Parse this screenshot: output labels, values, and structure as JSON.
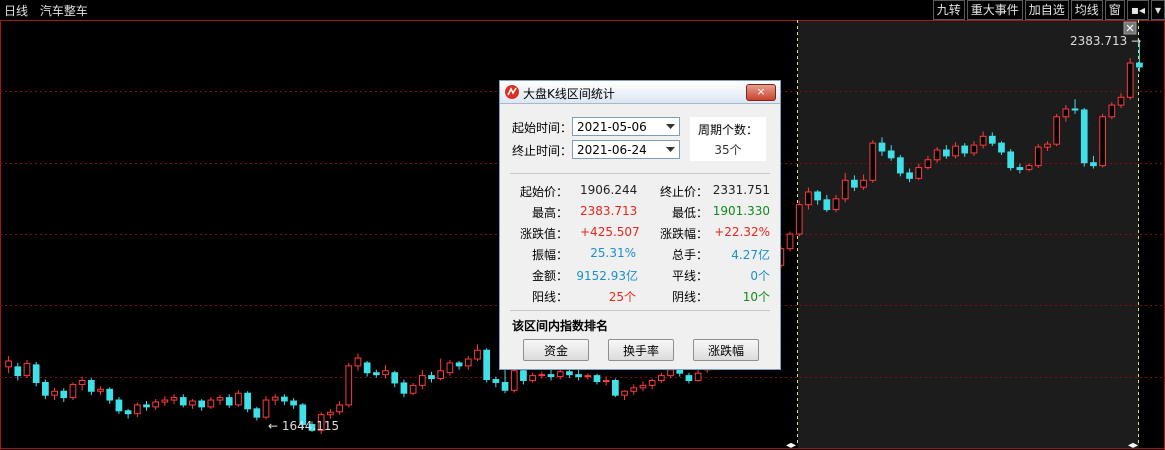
{
  "header": {
    "period": "日线",
    "sector": "汽车整车"
  },
  "toolbar": [
    "九转",
    "重大事件",
    "加自选",
    "均线",
    "窗",
    "▪◂",
    "▾"
  ],
  "chart_data": {
    "type": "candlestick",
    "max_label": "2383.713",
    "min_label": "1644.115",
    "candles": [
      [
        1718,
        1730,
        1705,
        1740
      ],
      [
        1718,
        1700,
        1690,
        1726
      ],
      [
        1700,
        1725,
        1695,
        1732
      ],
      [
        1722,
        1686,
        1678,
        1728
      ],
      [
        1686,
        1660,
        1652,
        1692
      ],
      [
        1660,
        1668,
        1650,
        1675
      ],
      [
        1668,
        1655,
        1646,
        1674
      ],
      [
        1655,
        1682,
        1650,
        1686
      ],
      [
        1682,
        1690,
        1670,
        1698
      ],
      [
        1690,
        1668,
        1660,
        1695
      ],
      [
        1668,
        1672,
        1660,
        1678
      ],
      [
        1672,
        1650,
        1642,
        1676
      ],
      [
        1650,
        1628,
        1622,
        1656
      ],
      [
        1628,
        1622,
        1612,
        1632
      ],
      [
        1622,
        1640,
        1615,
        1645
      ],
      [
        1640,
        1636,
        1628,
        1648
      ],
      [
        1636,
        1646,
        1630,
        1652
      ],
      [
        1646,
        1650,
        1638,
        1658
      ],
      [
        1650,
        1655,
        1642,
        1662
      ],
      [
        1655,
        1640,
        1635,
        1662
      ],
      [
        1640,
        1648,
        1632,
        1652
      ],
      [
        1648,
        1636,
        1628,
        1652
      ],
      [
        1636,
        1650,
        1632,
        1656
      ],
      [
        1650,
        1655,
        1640,
        1660
      ],
      [
        1655,
        1640,
        1634,
        1662
      ],
      [
        1640,
        1664,
        1636,
        1670
      ],
      [
        1664,
        1632,
        1625,
        1668
      ],
      [
        1632,
        1615,
        1608,
        1636
      ],
      [
        1615,
        1650,
        1610,
        1658
      ],
      [
        1650,
        1656,
        1640,
        1662
      ],
      [
        1656,
        1648,
        1640,
        1662
      ],
      [
        1648,
        1640,
        1632,
        1654
      ],
      [
        1640,
        1600,
        1592,
        1644
      ],
      [
        1600,
        1588,
        1585,
        1606
      ],
      [
        1588,
        1620,
        1580,
        1625
      ],
      [
        1620,
        1625,
        1612,
        1632
      ],
      [
        1626,
        1640,
        1620,
        1648
      ],
      [
        1640,
        1720,
        1635,
        1726
      ],
      [
        1720,
        1736,
        1710,
        1745
      ],
      [
        1726,
        1706,
        1698,
        1730
      ],
      [
        1706,
        1702,
        1696,
        1712
      ],
      [
        1702,
        1710,
        1694,
        1722
      ],
      [
        1706,
        1685,
        1676,
        1710
      ],
      [
        1685,
        1664,
        1656,
        1692
      ],
      [
        1664,
        1680,
        1660,
        1685
      ],
      [
        1680,
        1700,
        1672,
        1712
      ],
      [
        1700,
        1694,
        1686,
        1708
      ],
      [
        1694,
        1710,
        1690,
        1735
      ],
      [
        1706,
        1726,
        1700,
        1732
      ],
      [
        1726,
        1720,
        1712,
        1730
      ],
      [
        1720,
        1734,
        1712,
        1740
      ],
      [
        1734,
        1752,
        1730,
        1764
      ],
      [
        1752,
        1692,
        1686,
        1756
      ],
      [
        1692,
        1686,
        1676,
        1698
      ],
      [
        1686,
        1670,
        1664,
        1712
      ],
      [
        1670,
        1710,
        1665,
        1716
      ],
      [
        1710,
        1690,
        1682,
        1724
      ],
      [
        1690,
        1700,
        1686,
        1706
      ],
      [
        1700,
        1702,
        1694,
        1708
      ],
      [
        1702,
        1698,
        1690,
        1712
      ],
      [
        1698,
        1708,
        1692,
        1715
      ],
      [
        1708,
        1702,
        1695,
        1712
      ],
      [
        1702,
        1698,
        1690,
        1712
      ],
      [
        1698,
        1700,
        1692,
        1704
      ],
      [
        1700,
        1688,
        1682,
        1704
      ],
      [
        1688,
        1690,
        1680,
        1698
      ],
      [
        1690,
        1660,
        1656,
        1694
      ],
      [
        1660,
        1668,
        1650,
        1670
      ],
      [
        1668,
        1675,
        1660,
        1682
      ],
      [
        1675,
        1680,
        1668,
        1688
      ],
      [
        1680,
        1690,
        1672,
        1694
      ],
      [
        1690,
        1700,
        1685,
        1706
      ],
      [
        1700,
        1712,
        1695,
        1718
      ],
      [
        1712,
        1705,
        1698,
        1718
      ],
      [
        1700,
        1690,
        1684,
        1706
      ],
      [
        1690,
        1705,
        1688,
        1712
      ],
      [
        1712,
        1722,
        1706,
        1728
      ],
      [
        1722,
        1730,
        1715,
        1738
      ],
      [
        1730,
        1740,
        1722,
        1748
      ],
      [
        1740,
        1760,
        1735,
        1768
      ],
      [
        1906,
        1896,
        1890,
        1912
      ],
      [
        1896,
        1910,
        1890,
        1914
      ],
      [
        1910,
        1906,
        1900,
        1914
      ],
      [
        1906,
        1926,
        1901,
        1930
      ],
      [
        1926,
        1960,
        1920,
        1965
      ],
      [
        1960,
        1990,
        1955,
        1995
      ],
      [
        1990,
        2050,
        1985,
        2058
      ],
      [
        2050,
        2076,
        2040,
        2085
      ],
      [
        2076,
        2060,
        2050,
        2080
      ],
      [
        2060,
        2040,
        2035,
        2070
      ],
      [
        2040,
        2062,
        2035,
        2070
      ],
      [
        2062,
        2100,
        2055,
        2115
      ],
      [
        2100,
        2086,
        2078,
        2110
      ],
      [
        2086,
        2100,
        2080,
        2112
      ],
      [
        2100,
        2176,
        2095,
        2182
      ],
      [
        2176,
        2160,
        2150,
        2188
      ],
      [
        2160,
        2146,
        2140,
        2172
      ],
      [
        2146,
        2115,
        2108,
        2152
      ],
      [
        2115,
        2104,
        2096,
        2124
      ],
      [
        2104,
        2126,
        2100,
        2134
      ],
      [
        2126,
        2142,
        2122,
        2150
      ],
      [
        2142,
        2162,
        2136,
        2168
      ],
      [
        2162,
        2150,
        2144,
        2172
      ],
      [
        2150,
        2170,
        2145,
        2178
      ],
      [
        2170,
        2156,
        2148,
        2176
      ],
      [
        2156,
        2172,
        2150,
        2180
      ],
      [
        2172,
        2190,
        2165,
        2200
      ],
      [
        2190,
        2176,
        2170,
        2198
      ],
      [
        2176,
        2158,
        2152,
        2180
      ],
      [
        2158,
        2126,
        2120,
        2164
      ],
      [
        2126,
        2122,
        2114,
        2134
      ],
      [
        2122,
        2130,
        2118,
        2135
      ],
      [
        2130,
        2168,
        2125,
        2174
      ],
      [
        2168,
        2174,
        2160,
        2180
      ],
      [
        2174,
        2230,
        2170,
        2236
      ],
      [
        2230,
        2246,
        2220,
        2254
      ],
      [
        2246,
        2244,
        2236,
        2266
      ],
      [
        2244,
        2136,
        2128,
        2248
      ],
      [
        2136,
        2130,
        2124,
        2150
      ],
      [
        2130,
        2230,
        2126,
        2236
      ],
      [
        2230,
        2254,
        2225,
        2260
      ],
      [
        2254,
        2270,
        2248,
        2278
      ],
      [
        2270,
        2340,
        2265,
        2350
      ],
      [
        2340,
        2332,
        2322,
        2383.713
      ]
    ],
    "ylim": [
      1560,
      2420
    ]
  },
  "dialog": {
    "title": "大盘K线区间统计",
    "close": "×",
    "start_label": "起始时间：",
    "start_date": "2021-05-06",
    "end_label": "终止时间：",
    "end_date": "2021-06-24",
    "period_label": "周期个数：",
    "period_value": "35个",
    "stats": {
      "start_price_label": "起始价：",
      "start_price": "1906.244",
      "end_price_label": "终止价：",
      "end_price": "2331.751",
      "high_label": "最高：",
      "high": "2383.713",
      "low_label": "最低：",
      "low": "1901.330",
      "change_label": "涨跌值：",
      "change": "+425.507",
      "change_pct_label": "涨跌幅：",
      "change_pct": "+22.32%",
      "amp_label": "振幅：",
      "amp": "25.31%",
      "vol_label": "总手：",
      "vol": "4.27亿",
      "amount_label": "金额：",
      "amount": "9152.93亿",
      "flat_label": "平线：",
      "flat": "0个",
      "up_label": "阳线：",
      "up": "25个",
      "down_label": "阴线：",
      "down": "10个"
    },
    "rank_title": "该区间内指数排名",
    "buttons": [
      "资金",
      "换手率",
      "涨跌幅"
    ]
  }
}
